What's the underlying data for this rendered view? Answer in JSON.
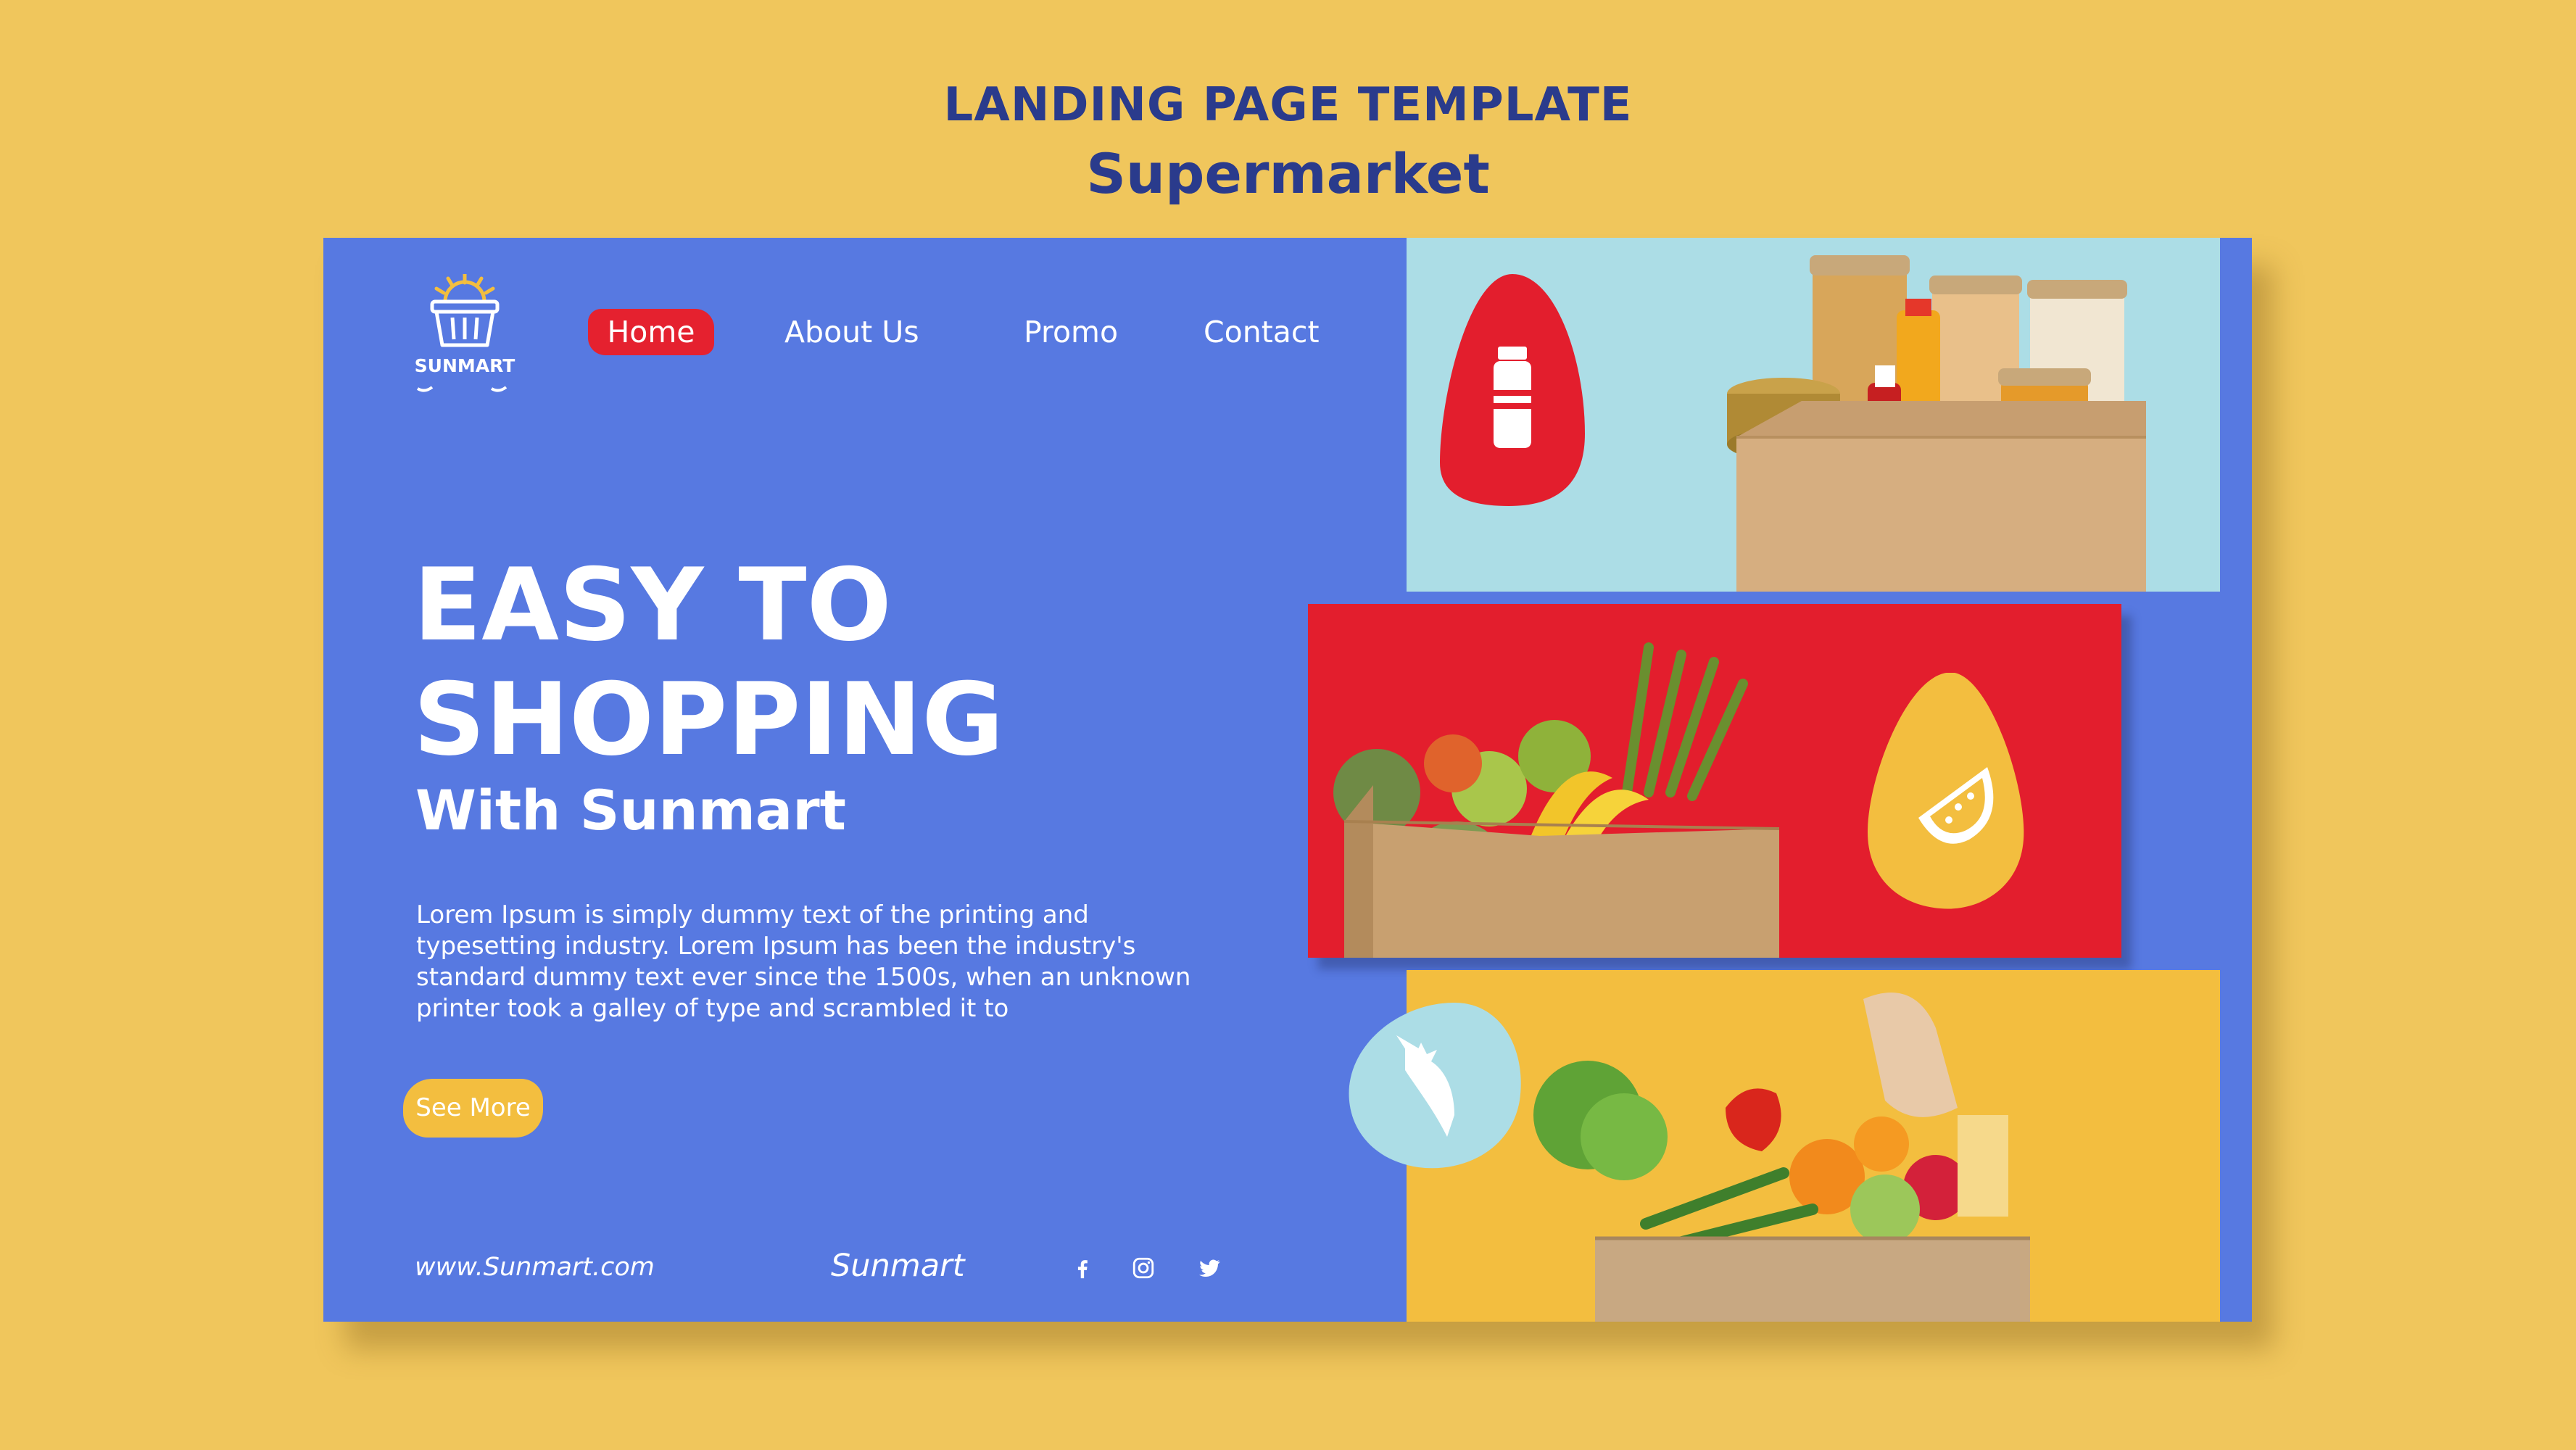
{
  "presentation": {
    "title": "LANDING PAGE TEMPLATE",
    "subtitle": "Supermarket"
  },
  "logo": {
    "name": "SUNMART",
    "icon": "basket-sun-icon"
  },
  "nav": {
    "home": "Home",
    "about": "About Us",
    "promo": "Promo",
    "contact": "Contact"
  },
  "hero": {
    "line1": "EASY TO",
    "line2": "SHOPPING",
    "line3": "With Sunmart",
    "body": "Lorem Ipsum is simply dummy text of the printing and typesetting industry. Lorem Ipsum has been the industry's standard dummy text ever since the 1500s, when an unknown printer took a galley of type and scrambled it to",
    "cta": "See More"
  },
  "footer": {
    "url": "www.Sunmart.com",
    "brand": "Sunmart",
    "social": [
      "facebook-icon",
      "instagram-icon",
      "twitter-icon"
    ]
  },
  "cards": [
    {
      "subject": "box of jars, cans and sauces",
      "badge_icon": "bottle-icon"
    },
    {
      "subject": "box of fruits and vegetables",
      "badge_icon": "watermelon-slice-icon"
    },
    {
      "subject": "box of groceries with bread and pasta",
      "badge_icon": "carrot-icon"
    }
  ],
  "colors": {
    "background": "#F0C65C",
    "primary_blue": "#5779E1",
    "title_navy": "#2A3B8C",
    "accent_red": "#E5212F",
    "accent_yellow": "#F3BE3F",
    "accent_light_blue": "#ACDDE6"
  }
}
